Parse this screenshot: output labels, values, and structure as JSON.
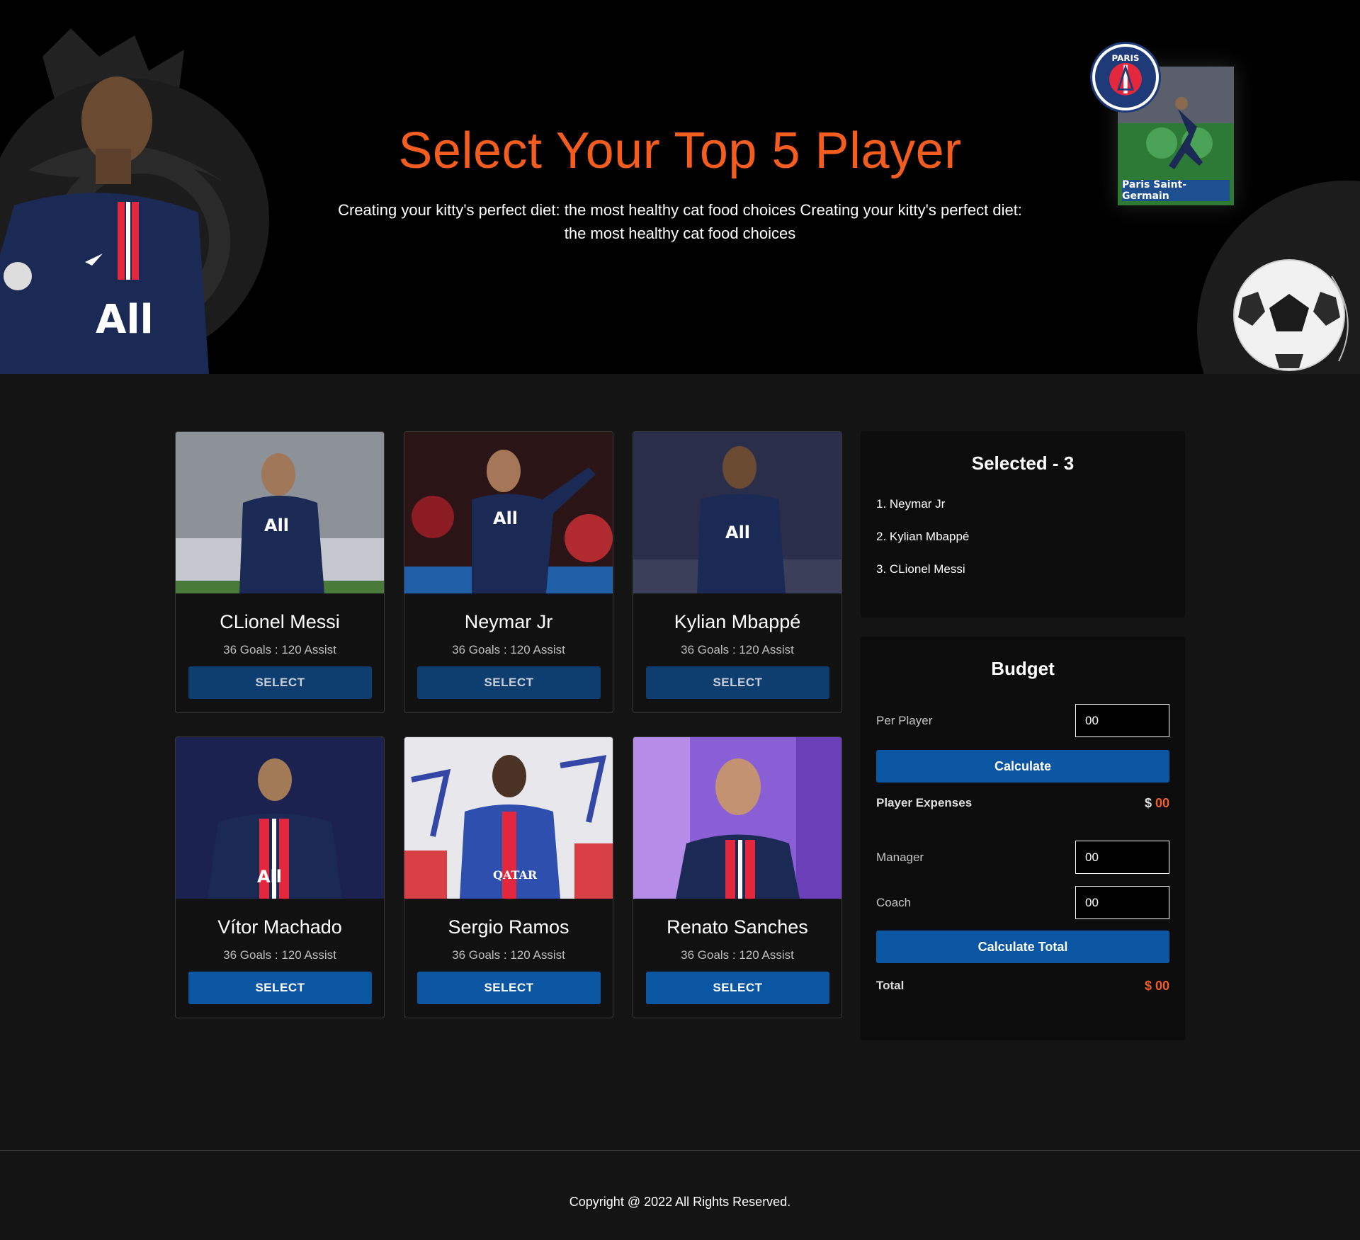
{
  "hero": {
    "title": "Select Your Top 5 Player",
    "subtitle": "Creating your kitty's perfect diet: the most healthy cat food choices Creating your kitty's perfect diet: the most healthy cat food choices",
    "card_caption": "Paris Saint-Germain",
    "badge_text": "PARIS"
  },
  "players": [
    {
      "name": "CLionel Messi",
      "stats": "36 Goals : 120 Assist",
      "button": "SELECT",
      "selected": true
    },
    {
      "name": "Neymar Jr",
      "stats": "36 Goals : 120 Assist",
      "button": "SELECT",
      "selected": true
    },
    {
      "name": "Kylian Mbappé",
      "stats": "36 Goals : 120 Assist",
      "button": "SELECT",
      "selected": true
    },
    {
      "name": "Vítor Machado",
      "stats": "36 Goals : 120 Assist",
      "button": "SELECT",
      "selected": false
    },
    {
      "name": "Sergio Ramos",
      "stats": "36 Goals : 120 Assist",
      "button": "SELECT",
      "selected": false
    },
    {
      "name": "Renato Sanches",
      "stats": "36 Goals : 120 Assist",
      "button": "SELECT",
      "selected": false
    }
  ],
  "selected": {
    "title": "Selected - 3",
    "items": [
      "1. Neymar Jr",
      "2. Kylian Mbappé",
      "3. CLionel Messi"
    ]
  },
  "budget": {
    "title": "Budget",
    "per_player_label": "Per Player",
    "per_player_value": "00",
    "calculate_label": "Calculate",
    "player_expenses_label": "Player Expenses",
    "player_expenses_currency": "$",
    "player_expenses_value": "00",
    "manager_label": "Manager",
    "manager_value": "00",
    "coach_label": "Coach",
    "coach_value": "00",
    "calculate_total_label": "Calculate Total",
    "total_label": "Total",
    "total_currency": "$",
    "total_value": "00"
  },
  "footer": {
    "copyright": "Copyright @ 2022 All Rights Reserved."
  },
  "colors": {
    "accent": "#f45d1f",
    "button_blue": "#0a56a3",
    "button_blue_disabled": "#0e3d70",
    "background": "#141414",
    "hero_background": "#000000"
  }
}
